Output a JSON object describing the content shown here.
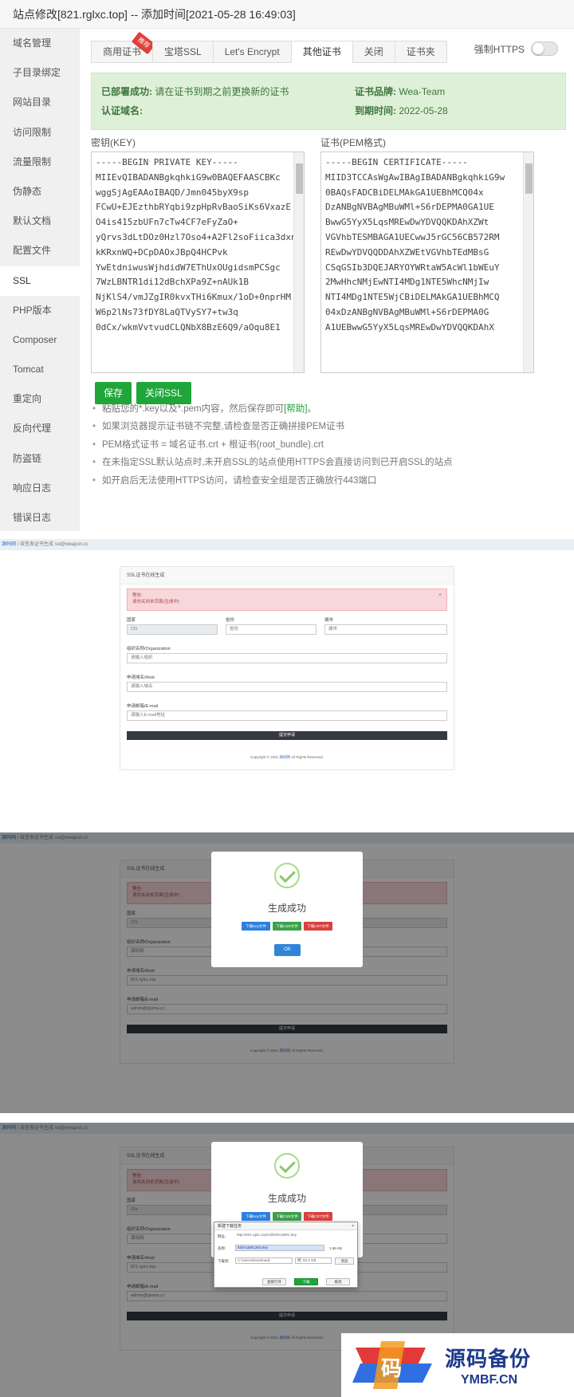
{
  "ssl_dialog": {
    "title": "站点修改[821.rglxc.top] -- 添加时间[2021-05-28 16:49:03]",
    "sidebar": [
      "域名管理",
      "子目录绑定",
      "网站目录",
      "访问限制",
      "流量限制",
      "伪静态",
      "默认文档",
      "配置文件",
      "SSL",
      "PHP版本",
      "Composer",
      "Tomcat",
      "重定向",
      "反向代理",
      "防盗链",
      "响应日志",
      "错误日志"
    ],
    "active_sidebar": "SSL",
    "tabs": [
      "商用证书",
      "宝塔SSL",
      "Let's Encrypt",
      "其他证书",
      "关闭",
      "证书夹"
    ],
    "active_tab": "其他证书",
    "tab_badge": "推荐",
    "force_https": "强制HTTPS",
    "deployed_label": "已部署成功:",
    "deployed_msg": "请在证书到期之前更换新的证书",
    "brand_label": "证书品牌:",
    "brand_value": "Wea-Team",
    "domain_label": "认证域名:",
    "expire_label": "到期时间:",
    "expire_value": "2022-05-28",
    "key_label": "密钥(KEY)",
    "cert_label": "证书(PEM格式)",
    "key_lines": [
      "-----BEGIN PRIVATE KEY-----",
      "MIIEvQIBADANBgkqhkiG9w0BAQEFAASCBKc",
      "wggSjAgEAAoIBAQD/Jmn045byX9sp",
      "FCwU+EJEzthbRYqbi9zpHpRvBaoSiKs6VxazE",
      "O4is415zbUFn7cTw4CF7eFyZaO+",
      "yQrvs3dLtDOz0Hzl7Oso4+A2Fl2soFiica3dxnv",
      "kKRxnWQ+DCpDAOxJBpQ4HCPvk",
      "YwEtdniwusWjhdidW7EThUxOUgidsmPCSgc",
      "7WzLBNTR1di12dBchXPa9Z+nAUk1B",
      "NjKlS4/vmJZgIR0kvxTHi6Kmux/1oD+0nprHM",
      "W6p2lNs73fDY8LaQTVySY7+tw3q",
      "0dCx/wkmVvtvudCLQNbX8BzE6Q9/aOqu8E1"
    ],
    "cert_lines": [
      "-----BEGIN CERTIFICATE-----",
      "MIID3TCCAsWgAwIBAgIBADANBgkqhkiG9w",
      "0BAQsFADCBiDELMAkGA1UEBhMCQ04x",
      "DzANBgNVBAgMBuWMl+S6rDEPMA0GA1UE",
      "BwwG5YyX5LqsMREwDwYDVQQKDAhXZWt",
      "VGVhbTESMBAGA1UECwwJ5rGC56CB572RM",
      "REwDwYDVQQDDAhXZWEtVGVhbTEdMBsG",
      "CSqGSIb3DQEJARYOYWRtaW5AcWl1bWEuY",
      "2MwHhcNMjEwNTI4MDg1NTE5WhcNMjIw",
      "NTI4MDg1NTE5WjCBiDELMAkGA1UEBhMCQ",
      "04xDzANBgNVBAgMBuWMl+S6rDEPMA0G",
      "A1UEBwwG5YyX5LqsMREwDwYDVQQKDAhX"
    ],
    "save_btn": "保存",
    "close_ssl_btn": "关闭SSL",
    "tips": [
      {
        "text": "粘贴您的*.key以及*.pem内容，然后保存即可",
        "link": "[帮助]",
        "tail": "。"
      },
      {
        "text": "如果浏览器提示证书链不完整,请检查是否正确拼接PEM证书",
        "link": "",
        "tail": ""
      },
      {
        "text": "PEM格式证书 = 域名证书.crt + 根证书(root_bundle).crt",
        "link": "",
        "tail": ""
      },
      {
        "text": "在未指定SSL默认站点时,未开启SSL的站点使用HTTPS会直接访问到已开启SSL的站点",
        "link": "",
        "tail": ""
      },
      {
        "text": "如开启后无法使用HTTPS访问，请检查安全组是否正确放行443端口",
        "link": "",
        "tail": ""
      }
    ]
  },
  "csr_tool": {
    "crumb_link": "源码网",
    "crumb_text": "/ 自签发证书生成 ssl@weapon.cc",
    "card_title": "SSL证书在线生成",
    "alert_title": "警告:",
    "alert_msg": "请勿关闭本页面(生成中)",
    "country_label": "国家",
    "country_value": "CN",
    "province_label": "省份",
    "province_ph": "省份",
    "city_label": "城市",
    "city_ph": "城市",
    "org_label": "组织名称/Organization",
    "org_ph": "请输入组织",
    "org_value": "源码网",
    "host_label": "申请域名/Host",
    "host_ph": "请输入域名",
    "host_value": "821.rglxc.top",
    "email_label": "申请邮箱/E-mail",
    "email_ph": "请输入E-mail地址",
    "email_value": "admin@qiuma.cc",
    "submit": "提交申请",
    "footer_pre": "Copyright © 2021",
    "footer_link": "源码网",
    "footer_post": "All Rights Reserved.",
    "success": "生成成功",
    "dl_key": "下载Key文件",
    "dl_csr": "下载CSR文件",
    "dl_crt": "下载CRT文件",
    "ok": "OK",
    "save_dialog_title": "新建下载任务",
    "url_label": "网址:",
    "url_value": "http://821.rglxc.top/ssl/830A1B9C.key",
    "name_label": "名称:",
    "name_value": "830A1B9C2E5.key",
    "size_value": "1.66 KB",
    "path_label": "下载到:",
    "path_value": "C:\\Users\\Downloads",
    "space_value": "剩: 60.3 GB",
    "browse": "浏览",
    "direct_open": "直接打开",
    "download": "下载",
    "cancel": "取消"
  },
  "watermark": {
    "cn": "源码备份",
    "en": "YMBF.CN",
    "glyph": "码"
  },
  "colors": {
    "accent": "#20a53a",
    "success_bg": "#dff0d8",
    "alert_bg": "#f8d7da",
    "dl_key": "#2f7fe0",
    "dl_csr": "#3aa14a",
    "dl_crt": "#d9413f",
    "brand": "#1d3a8a"
  }
}
